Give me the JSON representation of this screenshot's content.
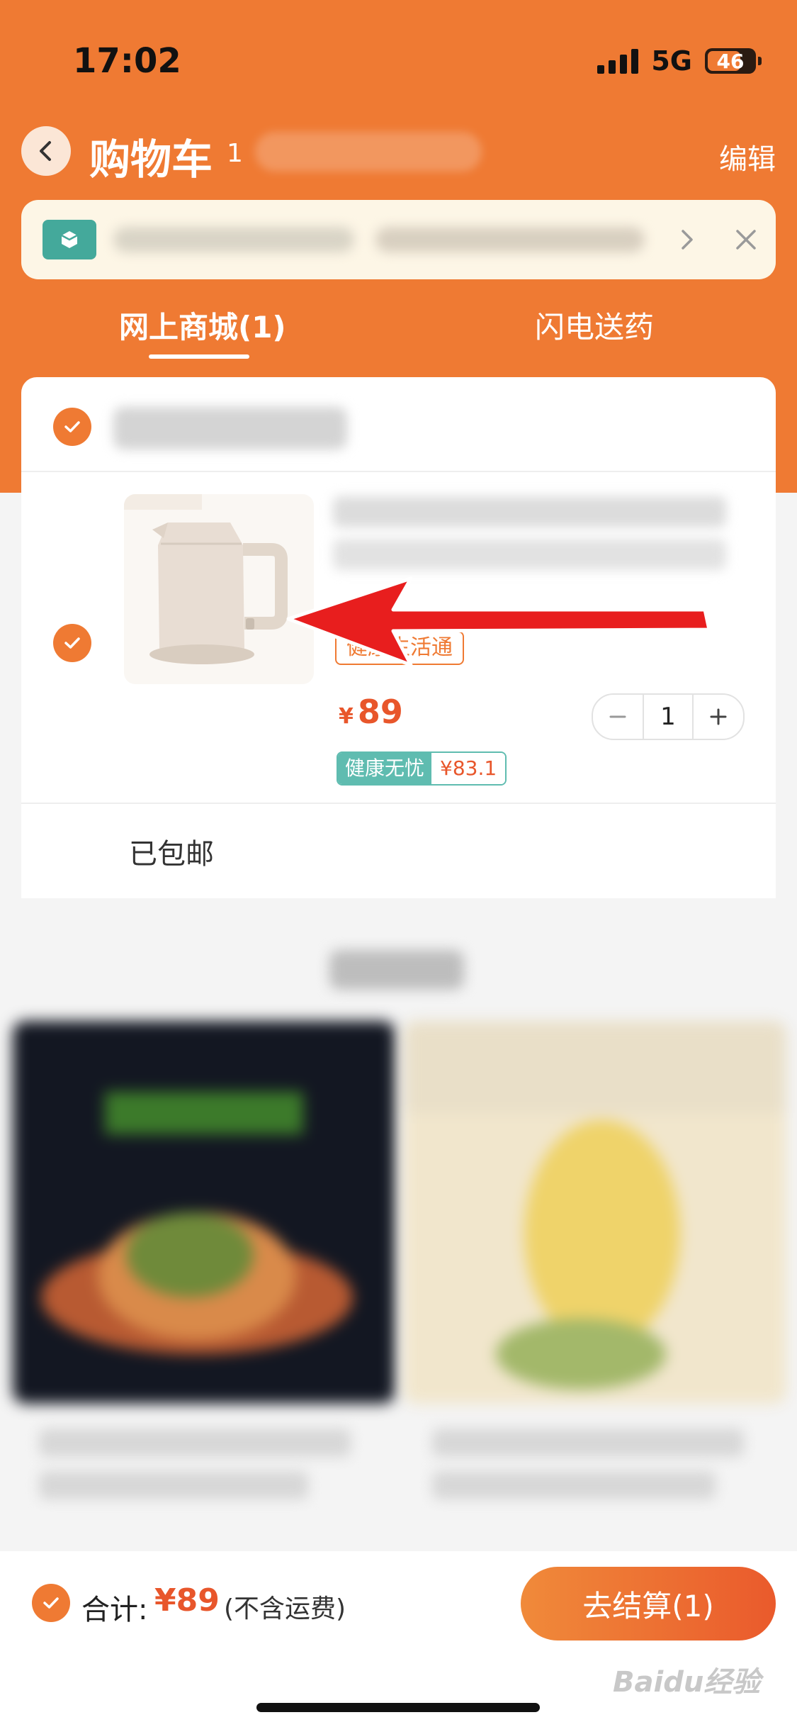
{
  "status_bar": {
    "time": "17:02",
    "network": "5G",
    "battery": "46"
  },
  "header": {
    "title": "购物车",
    "count": "1",
    "edit_label": "编辑"
  },
  "tabs": [
    {
      "label": "网上商城(1)",
      "active": true
    },
    {
      "label": "闪电送药",
      "active": false
    }
  ],
  "cart": {
    "item": {
      "tag": "健康生活通",
      "price_currency": "¥",
      "price": "89",
      "quantity": "1",
      "health_tag_label": "健康无忧",
      "health_tag_price": "¥83.1"
    },
    "shipping": "已包邮"
  },
  "footer": {
    "total_label": "合计:",
    "total_price": "¥89",
    "total_note": "(不含运费)",
    "checkout_label": "去结算(1)"
  },
  "watermark": "Baidu经验",
  "colors": {
    "accent": "#ef7a33",
    "price": "#e8562b",
    "teal": "#5fbcb0"
  },
  "icons": [
    "back-icon",
    "shield-icon",
    "chevron-right-icon",
    "close-icon",
    "check-icon",
    "minus-icon",
    "plus-icon",
    "kettle-image",
    "red-arrow"
  ]
}
